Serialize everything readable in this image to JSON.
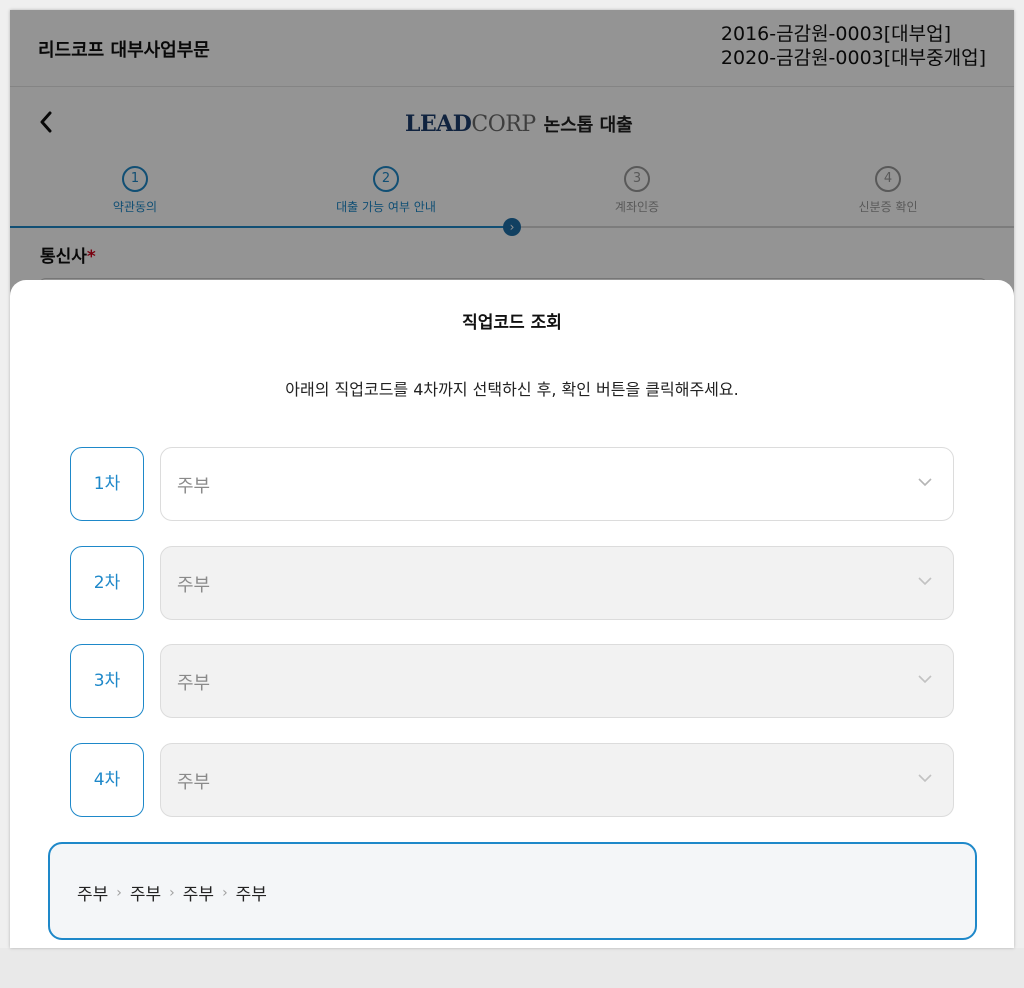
{
  "header": {
    "company": "리드코프 대부사업부문",
    "registrations": [
      "2016-금감원-0003[대부업]",
      "2020-금감원-0003[대부중개업]"
    ]
  },
  "nav": {
    "logo_main": "LEAD",
    "logo_sub": "CORP",
    "product": "논스톱 대출"
  },
  "steps": [
    {
      "num": "1",
      "label": "약관동의"
    },
    {
      "num": "2",
      "label": "대출 가능 여부 안내"
    },
    {
      "num": "3",
      "label": "계좌인증"
    },
    {
      "num": "4",
      "label": "신분증 확인"
    }
  ],
  "form": {
    "carrier_label": "통신사",
    "required_mark": "*"
  },
  "modal": {
    "title": "직업코드 조회",
    "description": "아래의 직업코드를 4차까지 선택하신 후, 확인 버튼을 클릭해주세요.",
    "levels": [
      {
        "label": "1차",
        "value": "주부"
      },
      {
        "label": "2차",
        "value": "주부"
      },
      {
        "label": "3차",
        "value": "주부"
      },
      {
        "label": "4차",
        "value": "주부"
      }
    ],
    "path": [
      "주부",
      "주부",
      "주부",
      "주부"
    ]
  },
  "colors": {
    "accent": "#1e88c9",
    "dark_accent": "#1e6fa8"
  }
}
